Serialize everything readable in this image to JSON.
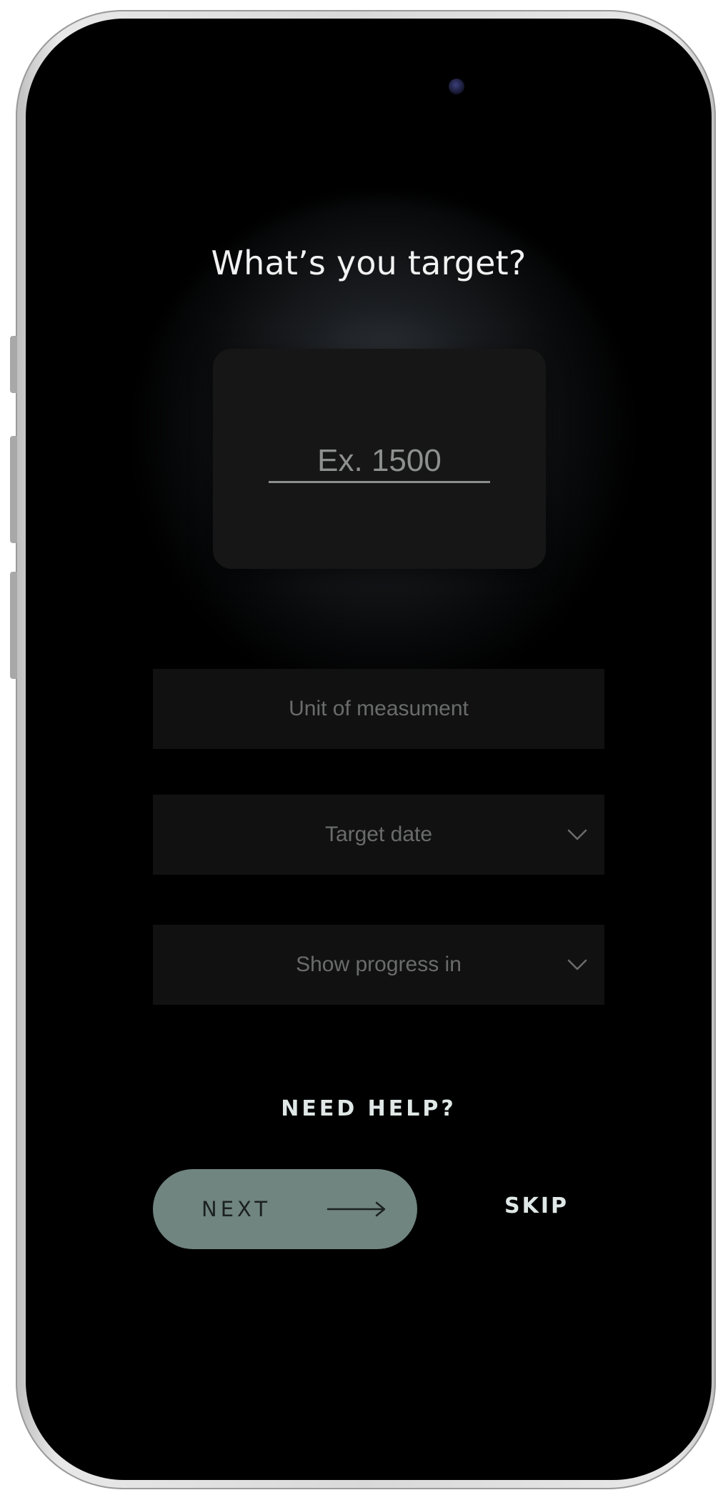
{
  "screen": {
    "title": "What’s you target?",
    "target_input": {
      "placeholder": "Ex. 1500",
      "value": ""
    },
    "unit_field": {
      "placeholder": "Unit of measument"
    },
    "target_date_field": {
      "label": "Target date",
      "icon": "chevron-down-icon"
    },
    "show_progress_field": {
      "label": "Show progress in",
      "icon": "chevron-down-icon"
    },
    "help_link": "NEED HELP?",
    "next_button": {
      "label": "NEXT",
      "icon": "arrow-right-icon"
    },
    "skip_button": "SKIP"
  },
  "colors": {
    "background": "#000000",
    "card": "#161616",
    "field": "#111111",
    "accent": "#708480",
    "text_primary": "#f2f2f2",
    "text_muted": "#6a6c6b"
  }
}
